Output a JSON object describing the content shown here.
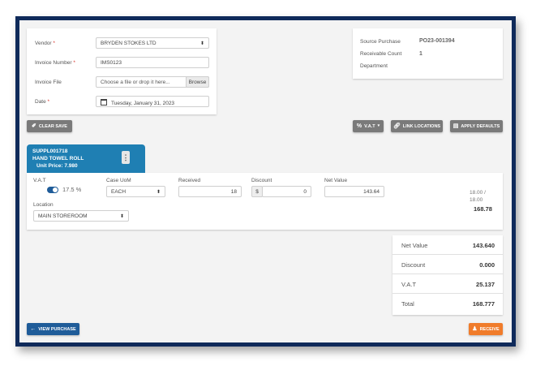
{
  "form": {
    "vendor_label": "Vendor",
    "vendor_value": "BRYDEN STOKES LTD",
    "invoice_number_label": "Invoice Number",
    "invoice_number_value": "IMS0123",
    "invoice_file_label": "Invoice File",
    "invoice_file_placeholder": "Choose a file or drop it here...",
    "browse_label": "Browse",
    "date_label": "Date",
    "date_value": "Tuesday, January 31, 2023",
    "required_mark": "*"
  },
  "info": {
    "source_purchase_label": "Source Purchase",
    "source_purchase_value": "PO23-001394",
    "receivable_count_label": "Receivable Count",
    "receivable_count_value": "1",
    "department_label": "Department"
  },
  "toolbar": {
    "clear_save": "CLEAR SAVE",
    "vat": "V.A.T",
    "link_locations": "LINK LOCATIONS",
    "apply_defaults": "APPLY DEFAULTS"
  },
  "item": {
    "code": "SUPPL001718",
    "name": "HAND TOWEL ROLL",
    "unit_price_label": "Unit Price:",
    "unit_price_value": "7.980",
    "vat_label": "V.A.T",
    "vat_rate": "17.5 %",
    "vat_enabled": true,
    "case_uom_label": "Case UoM",
    "case_uom_value": "EACH",
    "received_label": "Received",
    "received_value": "18",
    "discount_label": "Discount",
    "discount_prefix": "$",
    "discount_value": "0",
    "net_value_label": "Net Value",
    "net_value_value": "143.64",
    "quantity_ratio": "18.00 /",
    "quantity_total": "18.00",
    "line_total": "168.78",
    "location_label": "Location",
    "location_value": "MAIN STOREROOM"
  },
  "totals": [
    {
      "label": "Net Value",
      "value": "143.640"
    },
    {
      "label": "Discount",
      "value": "0.000"
    },
    {
      "label": "V.A.T",
      "value": "25.137"
    },
    {
      "label": "Total",
      "value": "168.777"
    }
  ],
  "footer": {
    "view_purchase": "VIEW PURCHASE",
    "receive": "RECEIVE"
  },
  "colors": {
    "frame": "#0f2a5a",
    "item_header": "#1f7fb3",
    "view_purchase": "#1f5c99",
    "receive": "#f07c2b",
    "toggle": "#1f5c99"
  }
}
